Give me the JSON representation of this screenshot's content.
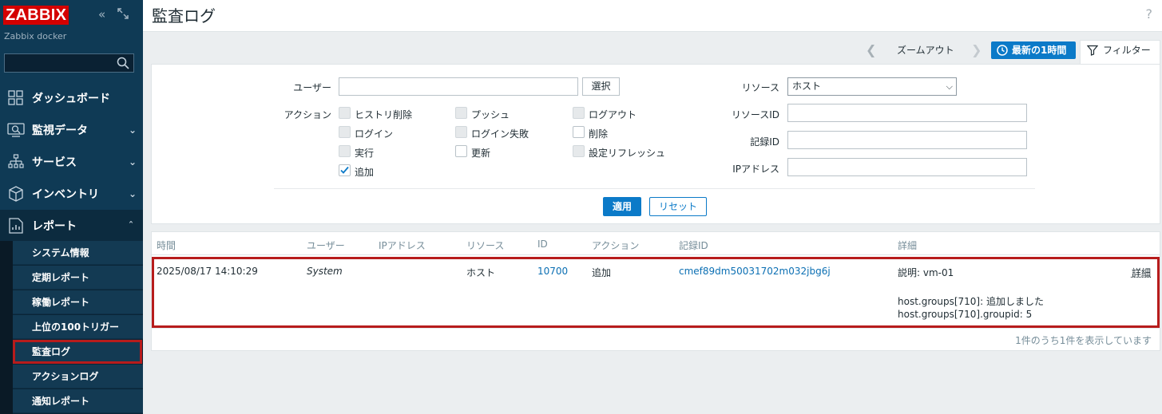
{
  "sidebar": {
    "logo": "ZABBIX",
    "server_name": "Zabbix docker",
    "menu": [
      {
        "label": "ダッシュボード"
      },
      {
        "label": "監視データ"
      },
      {
        "label": "サービス"
      },
      {
        "label": "インベントリ"
      },
      {
        "label": "レポート"
      }
    ],
    "submenu": [
      {
        "label": "システム情報"
      },
      {
        "label": "定期レポート"
      },
      {
        "label": "稼働レポート"
      },
      {
        "label": "上位の100トリガー"
      },
      {
        "label": "監査ログ"
      },
      {
        "label": "アクションログ"
      },
      {
        "label": "通知レポート"
      }
    ]
  },
  "header": {
    "title": "監査ログ",
    "help": "?"
  },
  "timebar": {
    "zoom_out": "ズームアウト",
    "latest": "最新の1時間",
    "filter_tab": "フィルター"
  },
  "filter": {
    "user_label": "ユーザー",
    "user_value": "",
    "select_button": "選択",
    "action_label": "アクション",
    "actions": [
      {
        "label": "ヒストリ削除",
        "checked": false,
        "disabled": true
      },
      {
        "label": "プッシュ",
        "checked": false,
        "disabled": true
      },
      {
        "label": "ログアウト",
        "checked": false,
        "disabled": true
      },
      {
        "label": "ログイン",
        "checked": false,
        "disabled": true
      },
      {
        "label": "ログイン失敗",
        "checked": false,
        "disabled": true
      },
      {
        "label": "削除",
        "checked": false,
        "disabled": false
      },
      {
        "label": "実行",
        "checked": false,
        "disabled": true
      },
      {
        "label": "更新",
        "checked": false,
        "disabled": false
      },
      {
        "label": "設定リフレッシュ",
        "checked": false,
        "disabled": true
      },
      {
        "label": "追加",
        "checked": true,
        "disabled": false
      }
    ],
    "resource_label": "リソース",
    "resource_value": "ホスト",
    "resource_id_label": "リソースID",
    "resource_id_value": "",
    "record_id_label": "記録ID",
    "record_id_value": "",
    "ip_label": "IPアドレス",
    "ip_value": "",
    "apply": "適用",
    "reset": "リセット"
  },
  "table": {
    "columns": [
      "時間",
      "ユーザー",
      "IPアドレス",
      "リソース",
      "ID",
      "アクション",
      "記録ID",
      "詳細"
    ],
    "rows": [
      {
        "time": "2025/08/17 14:10:29",
        "user": "System",
        "ip": "",
        "resource": "ホスト",
        "id": "10700",
        "action": "追加",
        "record_id": "cmef89dm50031702m032jbg6j",
        "detail_desc": "説明: vm-01",
        "detail_line1": "host.groups[710]: 追加しました",
        "detail_line2": "host.groups[710].groupid: 5",
        "details_link": "詳細"
      }
    ],
    "paging": "1件のうち1件を表示しています"
  }
}
